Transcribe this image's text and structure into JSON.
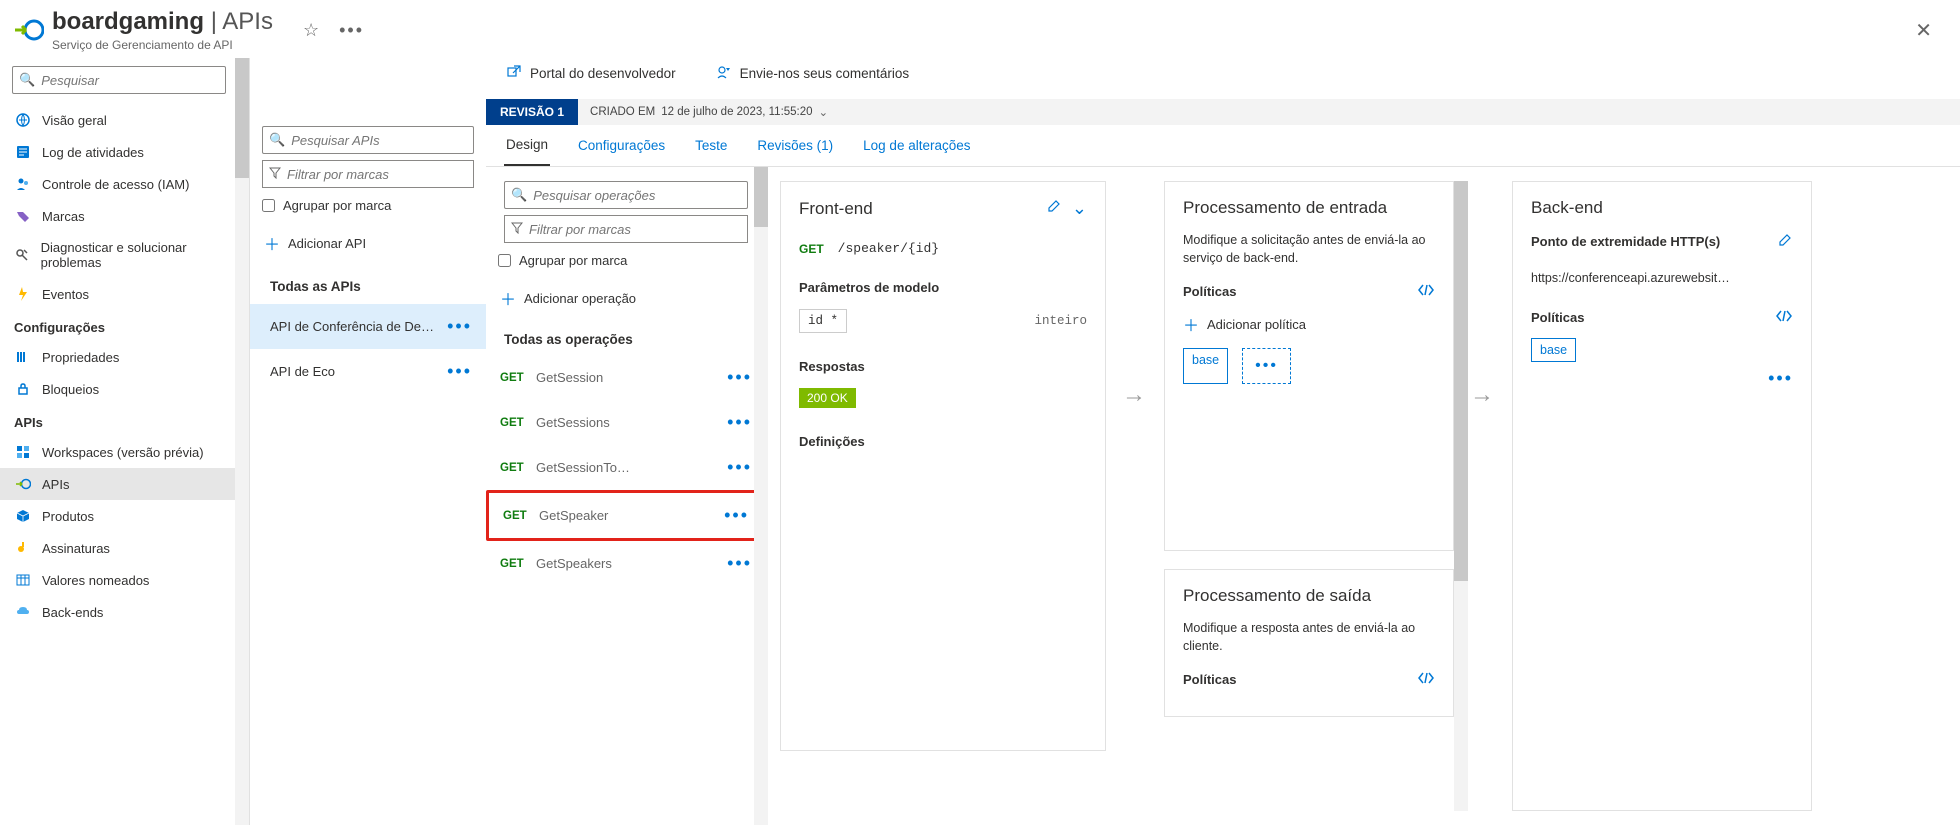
{
  "header": {
    "service_name": "boardgaming",
    "section": "APIs",
    "subtitle": "Serviço de Gerenciamento de API"
  },
  "nav": {
    "search_placeholder": "Pesquisar",
    "visao_geral": "Visão geral",
    "log_atividades": "Log de atividades",
    "controle_acesso": "Controle de acesso (IAM)",
    "marcas": "Marcas",
    "diagnosticar": "Diagnosticar e solucionar problemas",
    "eventos": "Eventos",
    "heading_config": "Configurações",
    "propriedades": "Propriedades",
    "bloqueios": "Bloqueios",
    "heading_apis": "APIs",
    "workspaces": "Workspaces (versão prévia)",
    "apis": "APIs",
    "produtos": "Produtos",
    "assinaturas": "Assinaturas",
    "valores": "Valores nomeados",
    "backends": "Back-ends"
  },
  "apis_col": {
    "search_placeholder": "Pesquisar APIs",
    "filter_placeholder": "Filtrar por marcas",
    "group_label": "Agrupar por marca",
    "add_api": "Adicionar API",
    "all_apis": "Todas as APIs",
    "items": [
      {
        "label": "API de Conferência de De…",
        "selected": true
      },
      {
        "label": "API de Eco",
        "selected": false
      }
    ]
  },
  "toolbar": {
    "portal": "Portal do desenvolvedor",
    "feedback": "Envie-nos seus comentários"
  },
  "revision": {
    "label": "REVISÃO 1",
    "created_prefix": "CRIADO EM",
    "created_value": "12 de julho de 2023, 11:55:20"
  },
  "tabs": {
    "design": "Design",
    "config": "Configurações",
    "teste": "Teste",
    "revisoes": "Revisões (1)",
    "log": "Log de alterações"
  },
  "ops": {
    "search_placeholder": "Pesquisar operações",
    "filter_placeholder": "Filtrar por marcas",
    "group_label": "Agrupar por marca",
    "add_op": "Adicionar operação",
    "all_ops": "Todas as operações",
    "list": [
      {
        "method": "GET",
        "name": "GetSession",
        "hl": false
      },
      {
        "method": "GET",
        "name": "GetSessions",
        "hl": false
      },
      {
        "method": "GET",
        "name": "GetSessionTo…",
        "hl": false
      },
      {
        "method": "GET",
        "name": "GetSpeaker",
        "hl": true
      },
      {
        "method": "GET",
        "name": "GetSpeakers",
        "hl": false
      }
    ]
  },
  "frontend": {
    "title": "Front-end",
    "method": "GET",
    "path": "/speaker/{id}",
    "params_title": "Parâmetros de modelo",
    "param_name": "id *",
    "param_type": "inteiro",
    "responses_title": "Respostas",
    "response_badge": "200 OK",
    "defs_title": "Definições"
  },
  "inbound": {
    "title": "Processamento de entrada",
    "desc": "Modifique a solicitação antes de enviá-la ao serviço de back-end.",
    "policies_title": "Políticas",
    "add_policy": "Adicionar política",
    "base": "base"
  },
  "outbound": {
    "title": "Processamento de saída",
    "desc": "Modifique a resposta antes de enviá-la ao cliente.",
    "policies_title": "Políticas"
  },
  "backend": {
    "title": "Back-end",
    "endpoint_label": "Ponto de extremidade HTTP(s)",
    "url": "https://conferenceapi.azurewebsit…",
    "policies_title": "Políticas",
    "base": "base"
  }
}
